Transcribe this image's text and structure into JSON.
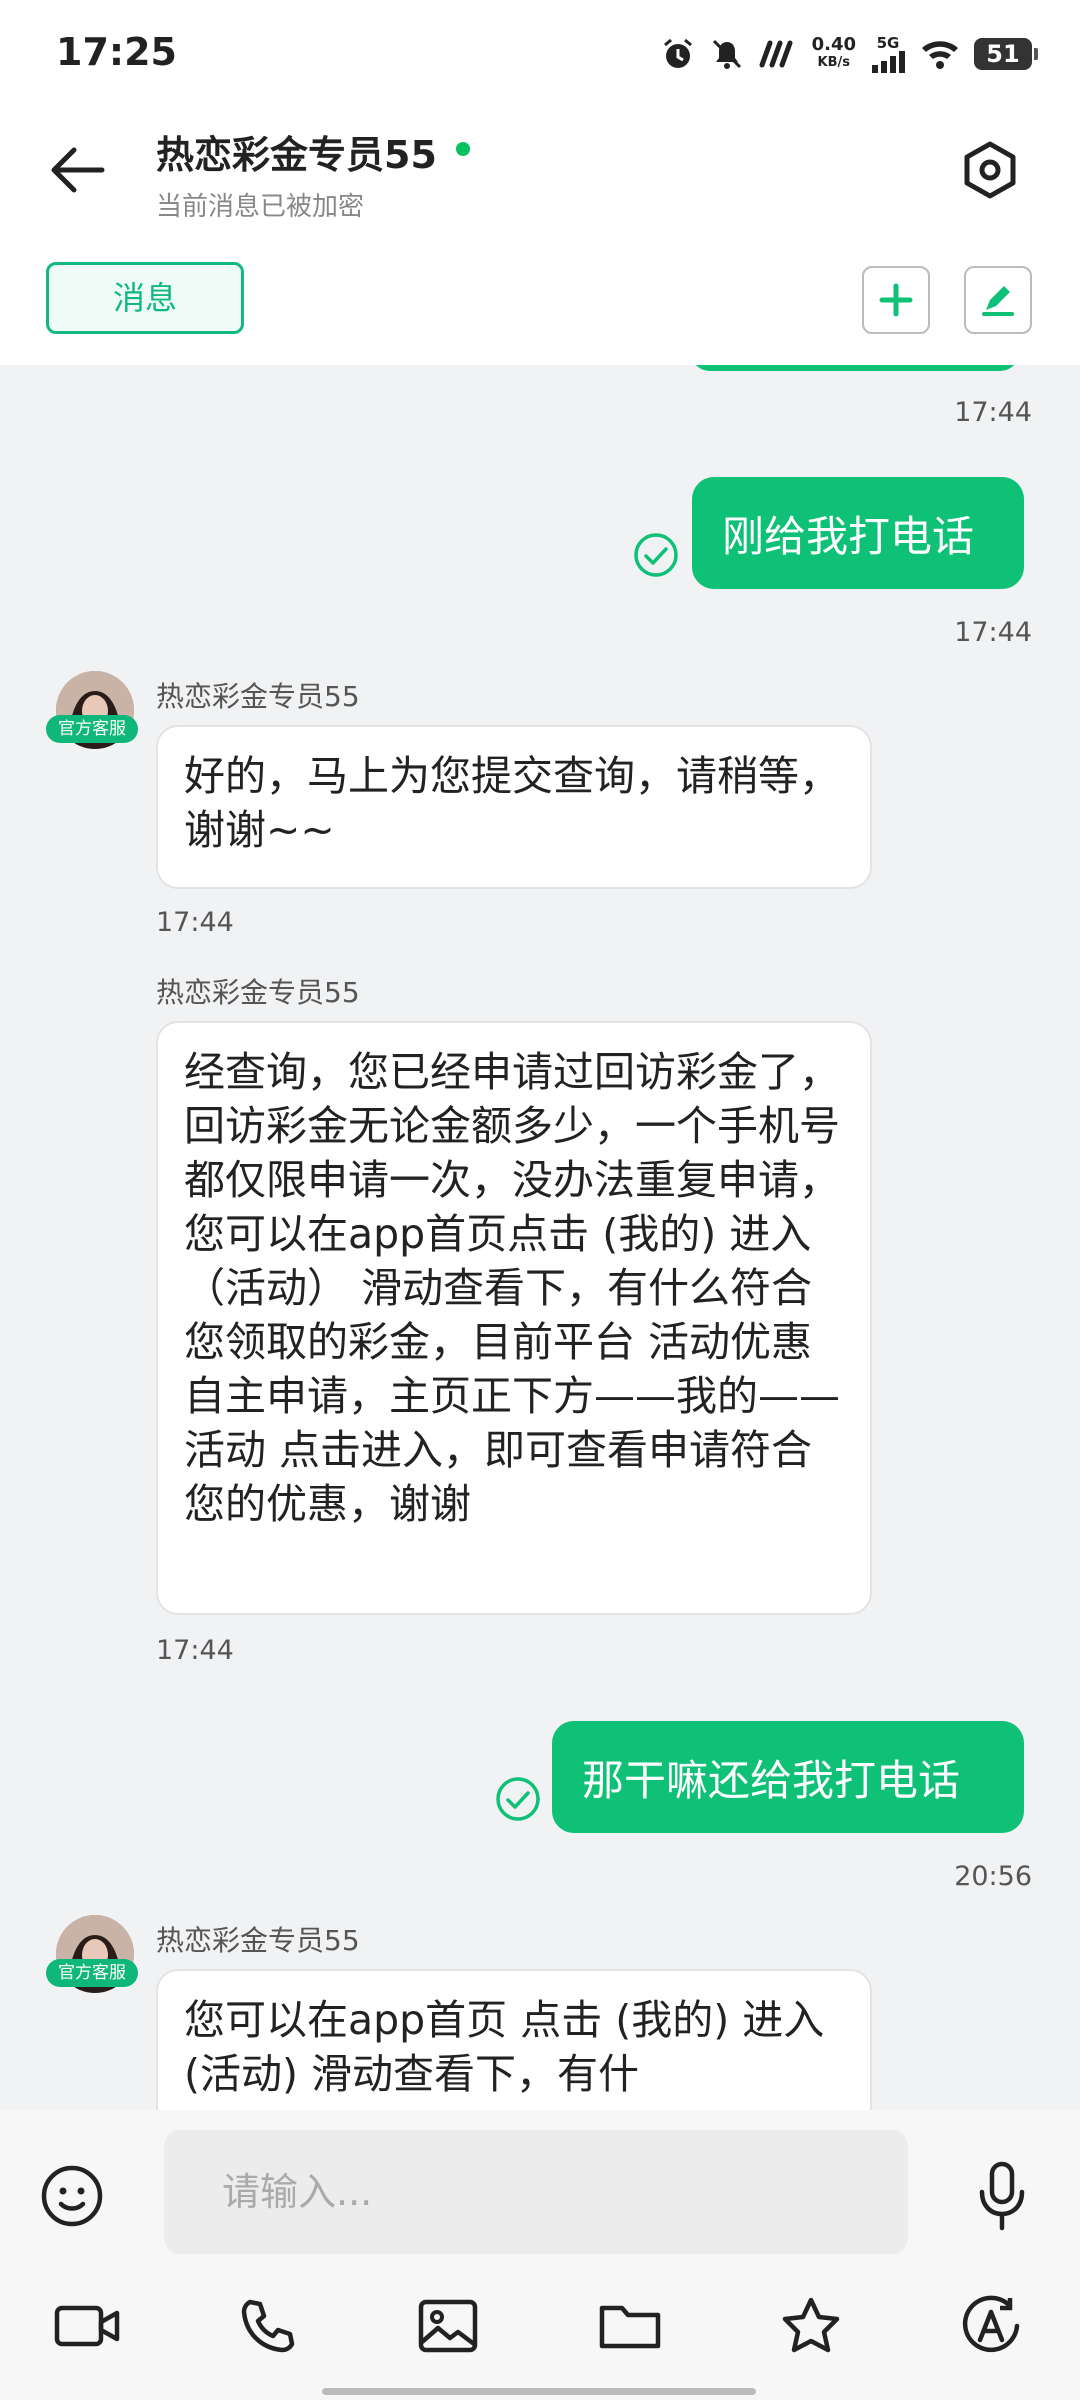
{
  "status_bar": {
    "time": "17:25",
    "net_speed_value": "0.40",
    "net_speed_unit": "KB/s",
    "network": "5G",
    "battery": "51"
  },
  "header": {
    "title": "热恋彩金专员55",
    "subtitle": "当前消息已被加密",
    "tab_label": "消息"
  },
  "messages": [
    {
      "type": "timestamp",
      "text": "17:44"
    },
    {
      "type": "outgoing",
      "text": "刚给我打电话"
    },
    {
      "type": "timestamp",
      "text": "17:44"
    },
    {
      "type": "incoming",
      "sender": "热恋彩金专员55",
      "badge": "官方客服",
      "text": "好的，马上为您提交查询，请稍等，谢谢~~",
      "time": "17:44"
    },
    {
      "type": "incoming",
      "sender": "热恋彩金专员55",
      "text": "经查询，您已经申请过回访彩金了，回访彩金无论金额多少，一个手机号都仅限申请一次，没办法重复申请，您可以在app首页点击 (我的) 进入 （活动） 滑动查看下，有什么符合您领取的彩金，目前平台 活动优惠自主申请，主页正下方——我的——活动 点击进入，即可查看申请符合您的优惠，谢谢",
      "time": "17:44"
    },
    {
      "type": "outgoing",
      "text": "那干嘛还给我打电话"
    },
    {
      "type": "timestamp",
      "text": "20:56"
    },
    {
      "type": "incoming",
      "sender": "热恋彩金专员55",
      "badge": "官方客服",
      "text": "您可以在app首页 点击 (我的) 进入 (活动) 滑动查看下，有什"
    }
  ],
  "input": {
    "placeholder": "请输入..."
  },
  "toolbar_icons": [
    "video-icon",
    "phone-icon",
    "image-icon",
    "folder-icon",
    "star-icon",
    "auto-translate-icon"
  ],
  "colors": {
    "accent": "#0fc077",
    "online": "#07c160",
    "chat_bg": "#f1f2f4"
  }
}
